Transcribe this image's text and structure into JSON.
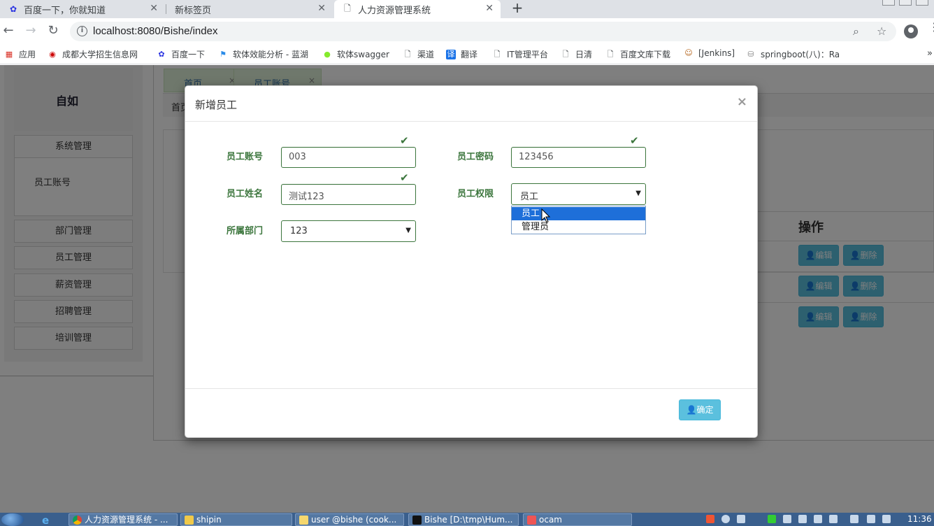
{
  "browser": {
    "tabs": [
      {
        "title": "百度一下，你就知道",
        "icon": "paw-icon"
      },
      {
        "title": "新标签页",
        "icon": ""
      },
      {
        "title": "人力资源管理系统",
        "icon": "page-icon",
        "active": true
      }
    ],
    "new_tab": "+",
    "url": "localhost:8080/Bishe/index",
    "bookmarks": [
      {
        "label": "应用",
        "icon": "apps-icon"
      },
      {
        "label": "成都大学招生信息网",
        "icon": "university-icon"
      },
      {
        "label": "百度一下",
        "icon": "paw-icon"
      },
      {
        "label": "软体效能分析 - 蓝湖",
        "icon": "lanhu-icon"
      },
      {
        "label": "软体swagger",
        "icon": "swagger-icon"
      },
      {
        "label": "渠道",
        "icon": "page-icon"
      },
      {
        "label": "翻译",
        "icon": "translate-icon"
      },
      {
        "label": "IT管理平台",
        "icon": "page-icon"
      },
      {
        "label": "日清",
        "icon": "page-icon"
      },
      {
        "label": "百度文库下载",
        "icon": "page-icon"
      },
      {
        "label": "[Jenkins]",
        "icon": "jenkins-icon"
      },
      {
        "label": "springboot(八)：Ra",
        "icon": "spring-icon"
      }
    ],
    "bookmarks_more": "»"
  },
  "app": {
    "logo": "自如",
    "sidebar": {
      "items": [
        "系统管理",
        "部门管理",
        "员工管理",
        "薪资管理",
        "招聘管理",
        "培训管理"
      ],
      "sub_items": [
        "员工账号"
      ]
    },
    "tabs": [
      {
        "label": "首页",
        "close": "×"
      },
      {
        "label": "员工账号",
        "close": "×"
      }
    ],
    "breadcrumb": "首页",
    "table": {
      "op_header": "操作",
      "edit_label": "编辑",
      "delete_label": "删除"
    }
  },
  "modal": {
    "title": "新增员工",
    "close": "×",
    "fields": {
      "account": {
        "label": "员工账号",
        "value": "003"
      },
      "password": {
        "label": "员工密码",
        "value": "123456"
      },
      "name": {
        "label": "员工姓名",
        "value": "测试123"
      },
      "role": {
        "label": "员工权限",
        "value": "员工",
        "options": [
          "员工",
          "管理员"
        ],
        "highlighted": "员工"
      },
      "dept": {
        "label": "所属部门",
        "value": "123"
      }
    },
    "confirm": "确定"
  },
  "taskbar": {
    "tasks": [
      "人力资源管理系统 - ...",
      "shipin",
      "user @bishe (cook...",
      "Bishe [D:\\tmp\\Hum...",
      "ocam"
    ],
    "clock": "11:36"
  },
  "colors": {
    "success_green": "#3c763d",
    "info_blue": "#5bc0de",
    "overlay": "rgba(0,0,0,0.5)",
    "select_highlight": "#1e6fd9"
  }
}
